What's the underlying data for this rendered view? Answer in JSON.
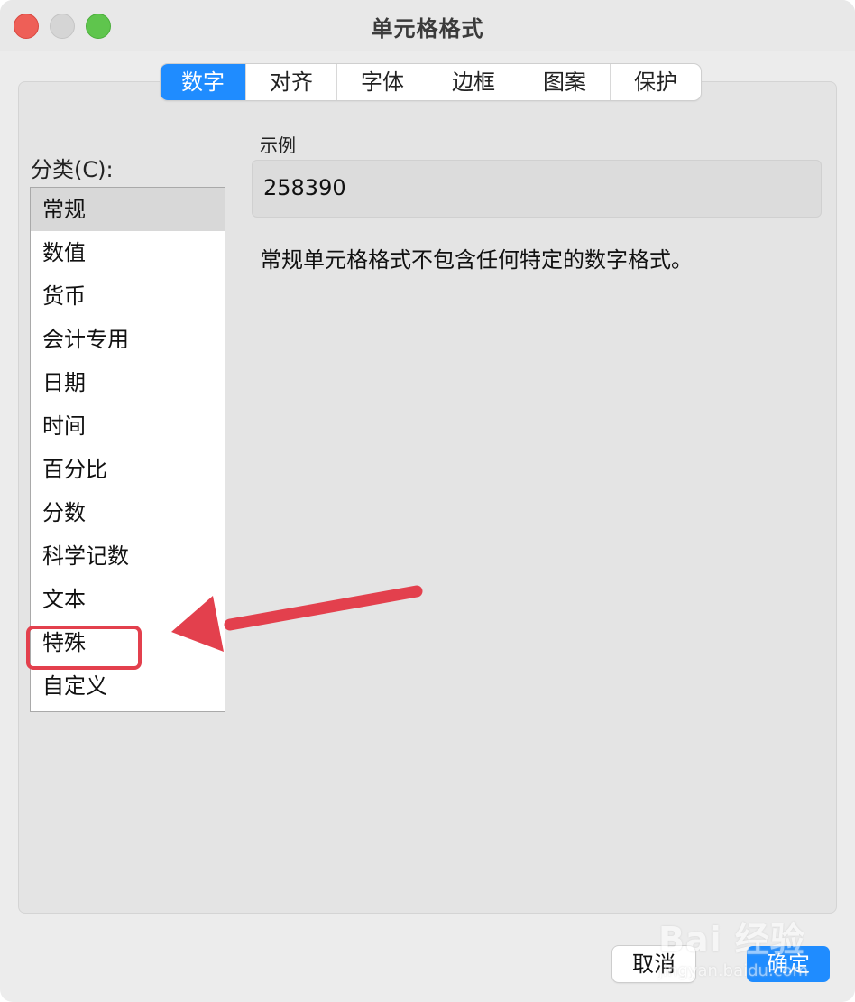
{
  "window": {
    "title": "单元格格式"
  },
  "tabs": [
    {
      "label": "数字",
      "active": true
    },
    {
      "label": "对齐",
      "active": false
    },
    {
      "label": "字体",
      "active": false
    },
    {
      "label": "边框",
      "active": false
    },
    {
      "label": "图案",
      "active": false
    },
    {
      "label": "保护",
      "active": false
    }
  ],
  "category": {
    "label": "分类(C):",
    "items": [
      "常规",
      "数值",
      "货币",
      "会计专用",
      "日期",
      "时间",
      "百分比",
      "分数",
      "科学记数",
      "文本",
      "特殊",
      "自定义"
    ],
    "selected": "常规",
    "highlighted": "特殊"
  },
  "sample": {
    "label": "示例",
    "value": "258390"
  },
  "description": "常规单元格格式不包含任何特定的数字格式。",
  "buttons": {
    "cancel": "取消",
    "ok": "确定"
  },
  "watermark": {
    "logo": "Bai 经验",
    "url": "jingyan.baidu.com"
  },
  "colors": {
    "accent": "#1f8cff",
    "annotation": "#e3404d"
  }
}
